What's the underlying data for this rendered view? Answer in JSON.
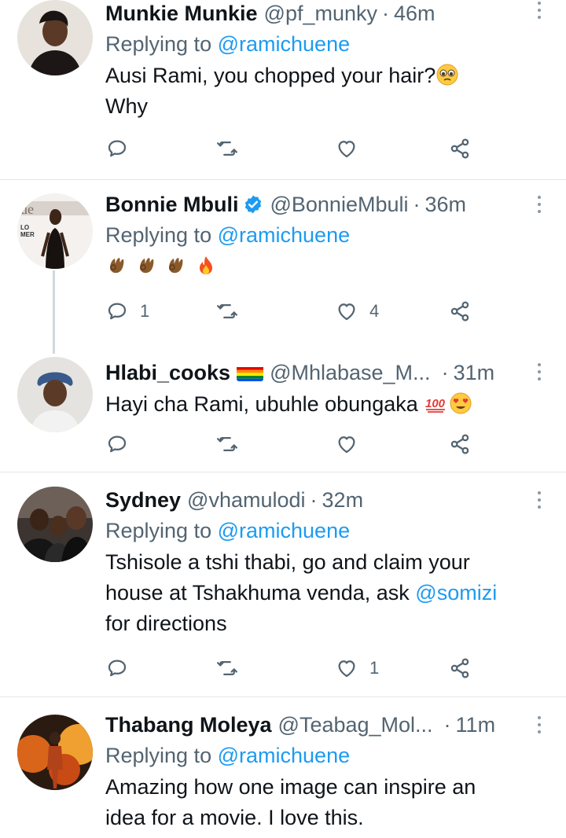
{
  "tweets": [
    {
      "name": "Munkie Munkie",
      "handle": "@pf_munky",
      "sep": "·",
      "time": "46m",
      "replying_prefix": "Replying to",
      "replying_to": "@ramichuene",
      "text_lines": [
        "Ausi Rami, you chopped your hair?",
        "Why"
      ],
      "replies": "",
      "likes": ""
    },
    {
      "name": "Bonnie Mbuli",
      "handle": "@BonnieMbuli",
      "sep": "·",
      "time": "36m",
      "replying_prefix": "Replying to",
      "replying_to": "@ramichuene",
      "replies": "1",
      "likes": "4"
    },
    {
      "name": "Hlabi_cooks",
      "handle": "@Mhlabase_M...",
      "sep": "·",
      "time": "31m",
      "text": "Hayi cha Rami, ubuhle obungaka",
      "replies": "",
      "likes": ""
    },
    {
      "name": "Sydney",
      "handle": "@vhamulodi",
      "sep": "·",
      "time": "32m",
      "replying_prefix": "Replying to",
      "replying_to": "@ramichuene",
      "text_line1": "Tshisole a tshi thabi, go and claim your",
      "text_line2_pre": "house at Tshakhuma venda, ask",
      "text_line2_mention": "@somizi",
      "text_line3": "for directions",
      "replies": "",
      "likes": "1"
    },
    {
      "name": "Thabang Moleya",
      "handle": "@Teabag_Mol...",
      "sep": "·",
      "time": "11m",
      "replying_prefix": "Replying to",
      "replying_to": "@ramichuene",
      "text_lines": [
        "Amazing how one image can inspire an",
        "idea for a movie. I love this."
      ]
    }
  ],
  "colors": {
    "link": "#1d9bf0",
    "secondary": "#536471",
    "verified": "#1d9bf0",
    "divider": "#e1e6ea"
  }
}
